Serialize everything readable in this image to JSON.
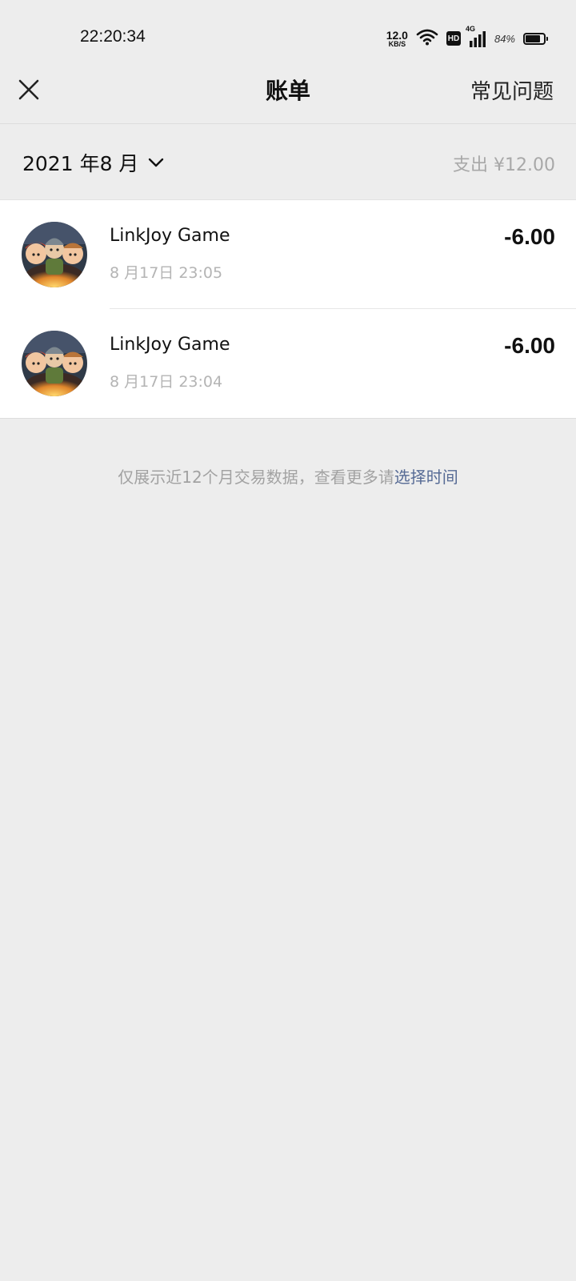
{
  "status_bar": {
    "time": "22:20:34",
    "net_speed_value": "12.0",
    "net_speed_unit": "KB/S",
    "hd_badge": "HD",
    "signal_tag": "4G",
    "battery_percent": "84%",
    "battery_level": 0.84,
    "icons": [
      "wifi-icon",
      "hd-icon",
      "signal-icon",
      "battery-icon"
    ]
  },
  "nav": {
    "close_icon": "close-icon",
    "title": "账单",
    "faq_label": "常见问题"
  },
  "month": {
    "label": "2021 年8 月",
    "chevron_icon": "chevron-down-icon",
    "total": "支出 ¥12.00"
  },
  "transactions": [
    {
      "name": "LinkJoy Game",
      "time": "8 月17日 23:05",
      "amount": "-6.00",
      "avatar_icon": "game-avatar"
    },
    {
      "name": "LinkJoy Game",
      "time": "8 月17日 23:04",
      "amount": "-6.00",
      "avatar_icon": "game-avatar"
    }
  ],
  "footer": {
    "note": "仅展示近12个月交易数据，查看更多请",
    "link": "选择时间"
  },
  "colors": {
    "background": "#ededed",
    "card": "#ffffff",
    "muted_text": "#a8a8a8",
    "link": "#576b95"
  }
}
